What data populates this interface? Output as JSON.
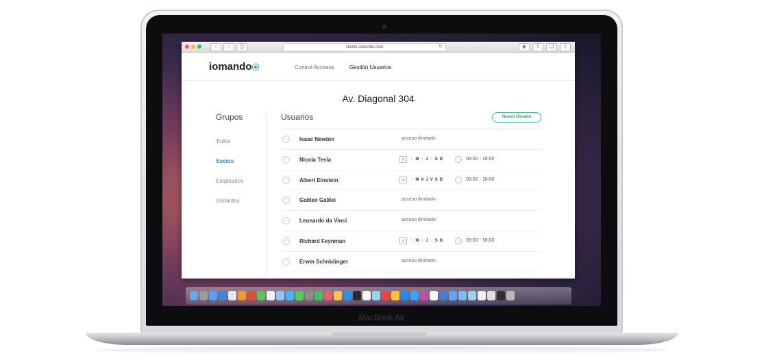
{
  "laptop": {
    "model_label": "MacBook Air"
  },
  "browser": {
    "url": "clients.iomando.com",
    "traffic_lights": [
      "#fc5d57",
      "#fdbc2e",
      "#27c940"
    ]
  },
  "app": {
    "logo": "iomando",
    "nav": [
      {
        "label": "Control Accesos",
        "active": false
      },
      {
        "label": "Gestión Usuarios",
        "active": true
      }
    ]
  },
  "page": {
    "title": "Av. Diagonal 304"
  },
  "sidebar": {
    "title": "Grupos",
    "items": [
      {
        "label": "Todos",
        "active": false
      },
      {
        "label": "Socios",
        "active": true
      },
      {
        "label": "Empleados",
        "active": false
      },
      {
        "label": "Visitantes",
        "active": false
      }
    ]
  },
  "users": {
    "title": "Usuarios",
    "new_button": "Nuevo Usuario",
    "rows": [
      {
        "name": "Isaac Newton",
        "access": "acceso ilimitado"
      },
      {
        "name": "Nicola Tesla",
        "days": [
          {
            "d": "L",
            "on": false
          },
          {
            "d": "M",
            "on": true
          },
          {
            "d": "X",
            "on": false
          },
          {
            "d": "J",
            "on": true
          },
          {
            "d": "V",
            "on": false
          },
          {
            "d": "S",
            "on": true
          },
          {
            "d": "D",
            "on": true
          }
        ],
        "hours": "09:00 - 18:00"
      },
      {
        "name": "Albert Einstein",
        "days": [
          {
            "d": "L",
            "on": false
          },
          {
            "d": "M",
            "on": true
          },
          {
            "d": "X",
            "on": true
          },
          {
            "d": "J",
            "on": true
          },
          {
            "d": "V",
            "on": true
          },
          {
            "d": "S",
            "on": true
          },
          {
            "d": "D",
            "on": true
          }
        ],
        "hours": "09:00 - 18:00"
      },
      {
        "name": "Galileo Galilei",
        "access": "acceso ilimitado"
      },
      {
        "name": "Leonardo da Vinci",
        "access": "acceso ilimitado"
      },
      {
        "name": "Richard Feynman",
        "days": [
          {
            "d": "L",
            "on": false
          },
          {
            "d": "M",
            "on": true
          },
          {
            "d": "X",
            "on": false
          },
          {
            "d": "J",
            "on": true
          },
          {
            "d": "V",
            "on": false
          },
          {
            "d": "S",
            "on": true
          },
          {
            "d": "D",
            "on": true
          }
        ],
        "hours": "09:00 - 18:00"
      },
      {
        "name": "Erwin Schrödinger",
        "access": "acceso ilimitado"
      }
    ]
  },
  "dock": {
    "colors": [
      "#6aa5e6",
      "#9c9c9c",
      "#4da3ff",
      "#3f86d8",
      "#e8e8e8",
      "#f39a2d",
      "#d94f3d",
      "#5fbf5a",
      "#f2f2f2",
      "#8fc6f5",
      "#48b3f7",
      "#56c959",
      "#8d8d8d",
      "#46c35b",
      "#e85e6a",
      "#f4c54a",
      "#2f8fe8",
      "#2b2b2b",
      "#f7f7f7",
      "#9ad3f2",
      "#e8483c",
      "#ffc23a",
      "#1f8cf0",
      "#3aa1ff",
      "#c34d9e",
      "#ffffff",
      "#4b7bd4",
      "#62a7e9",
      "#7dbbea",
      "#9fcff5",
      "#f0f0f0",
      "#e0e0e0",
      "#2f2f2f",
      "#bababa"
    ]
  }
}
